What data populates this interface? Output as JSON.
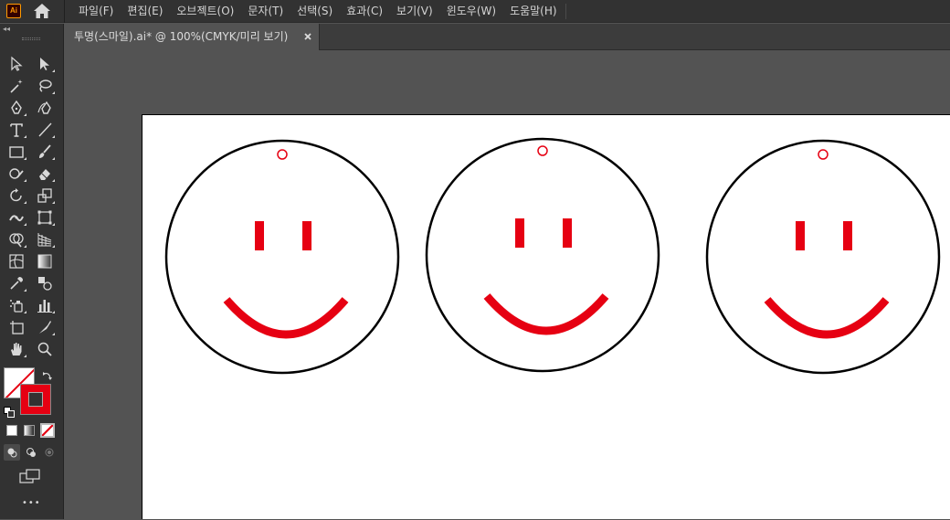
{
  "app": {
    "logo_text": "Ai",
    "home_icon": "home-icon"
  },
  "menu": {
    "items": [
      "파일(F)",
      "편집(E)",
      "오브젝트(O)",
      "문자(T)",
      "선택(S)",
      "효과(C)",
      "보기(V)",
      "윈도우(W)",
      "도움말(H)"
    ]
  },
  "document": {
    "tab_title": "투명(스마일).ai* @ 100%(CMYK/미리 보기)",
    "close_icon": "close-icon"
  },
  "colors": {
    "accent_red": "#e60012",
    "artboard": "#ffffff",
    "canvas": "#535353",
    "ui_dark": "#323232"
  },
  "artwork": {
    "objects": [
      "smiley-face",
      "smiley-face",
      "smiley-face"
    ]
  },
  "toolbar": {
    "more_label": "•••"
  }
}
